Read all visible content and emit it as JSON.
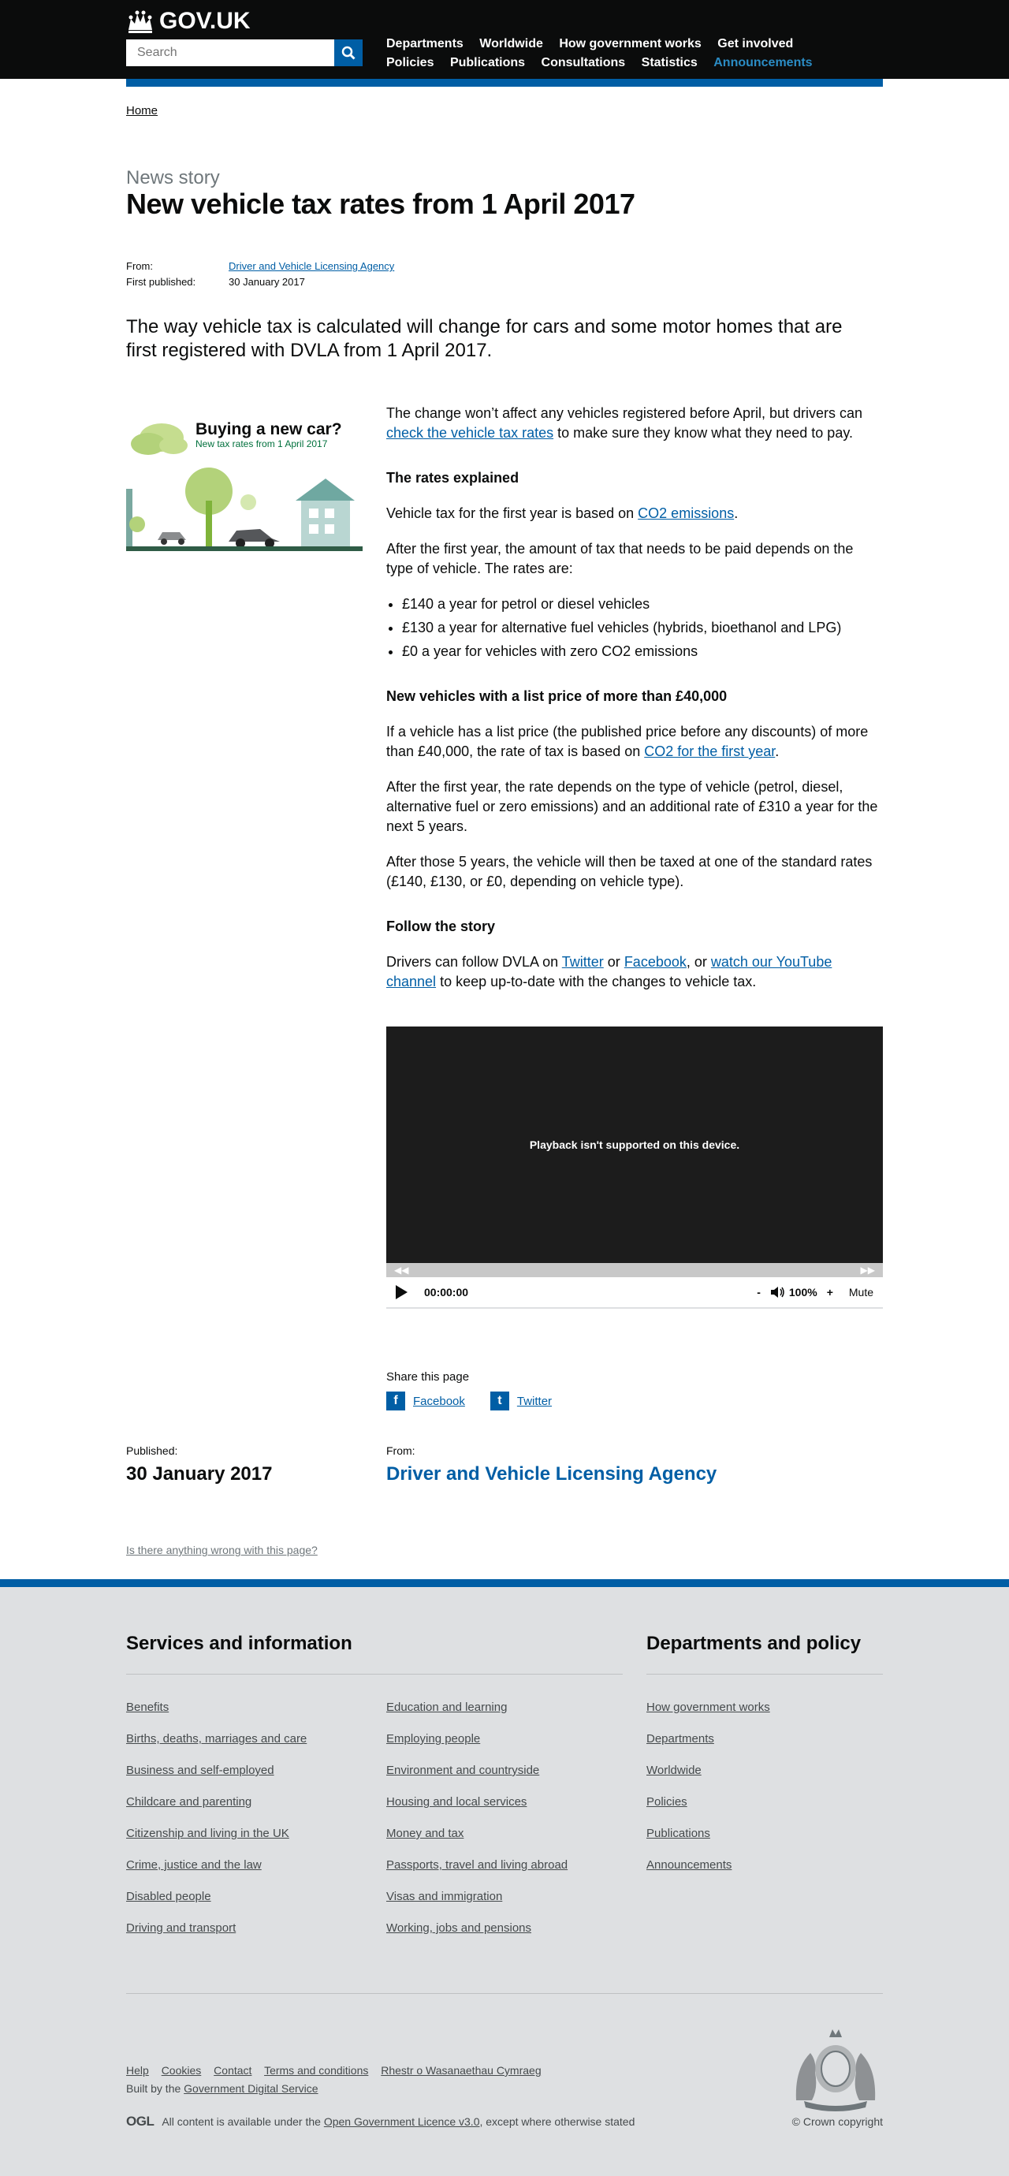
{
  "header": {
    "logo_text": "GOV.UK",
    "search_placeholder": "Search",
    "nav": [
      "Departments",
      "Worldwide",
      "How government works",
      "Get involved",
      "Policies",
      "Publications",
      "Consultations",
      "Statistics",
      "Announcements"
    ],
    "active_nav": "Announcements"
  },
  "breadcrumb": {
    "home": "Home"
  },
  "article": {
    "type": "News story",
    "title": "New vehicle tax rates from 1 April 2017",
    "from_label": "From:",
    "from_value": "Driver and Vehicle Licensing Agency",
    "first_published_label": "First published:",
    "first_published_value": "30 January 2017",
    "lead": "The way vehicle tax is calculated will change for cars and some motor homes that are first registered with DVLA from 1 April 2017.",
    "figure": {
      "heading": "Buying a new car?",
      "subheading": "New tax rates from 1 April 2017"
    },
    "p1_before": "The change won’t affect any vehicles registered before April, but drivers can ",
    "p1_link": "check the vehicle tax rates",
    "p1_after": " to make sure they know what they need to pay.",
    "h_rates": "The rates explained",
    "p2_before": "Vehicle tax for the first year is based on ",
    "p2_link": "CO2 emissions",
    "p2_after": ".",
    "p3": "After the first year, the amount of tax that needs to be paid depends on the type of vehicle. The rates are:",
    "rates": [
      "£140 a year for petrol or diesel vehicles",
      "£130 a year for alternative fuel vehicles (hybrids, bioethanol and LPG)",
      "£0 a year for vehicles with zero CO2 emissions"
    ],
    "h_list": "New vehicles with a list price of more than £40,000",
    "p4_before": "If a vehicle has a list price (the published price before any discounts) of more than £40,000, the rate of tax is based on ",
    "p4_link": "CO2 for the first year",
    "p4_after": ".",
    "p5": "After the first year, the rate depends on the type of vehicle (petrol, diesel, alternative fuel or zero emissions) and an additional rate of £310 a year for the next 5 years.",
    "p6": "After those 5 years, the vehicle will then be taxed at one of the standard rates (£140, £130, or £0, depending on vehicle type).",
    "h_follow": "Follow the story",
    "p7_a": "Drivers can follow DVLA on ",
    "p7_twitter": "Twitter",
    "p7_b": " or ",
    "p7_facebook": "Facebook",
    "p7_c": ", or ",
    "p7_youtube": "watch our YouTube channel",
    "p7_d": " to keep up-to-date with the changes to vehicle tax."
  },
  "video": {
    "message": "Playback isn't supported on this device.",
    "time": "00:00:00",
    "vol_down": "-",
    "volume": "100%",
    "vol_up": "+",
    "mute": "Mute",
    "progress": 0
  },
  "share": {
    "label": "Share this page",
    "facebook": "Facebook",
    "twitter": "Twitter"
  },
  "published": {
    "label": "Published:",
    "value": "30 January 2017"
  },
  "from": {
    "label": "From:",
    "value": "Driver and Vehicle Licensing Agency"
  },
  "report_link": "Is there anything wrong with this page?",
  "footer": {
    "services_heading": "Services and information",
    "services_col1": [
      "Benefits",
      "Births, deaths, marriages and care",
      "Business and self-employed",
      "Childcare and parenting",
      "Citizenship and living in the UK",
      "Crime, justice and the law",
      "Disabled people",
      "Driving and transport"
    ],
    "services_col2": [
      "Education and learning",
      "Employing people",
      "Environment and countryside",
      "Housing and local services",
      "Money and tax",
      "Passports, travel and living abroad",
      "Visas and immigration",
      "Working, jobs and pensions"
    ],
    "dept_heading": "Departments and policy",
    "dept_links": [
      "How government works",
      "Departments",
      "Worldwide",
      "Policies",
      "Publications",
      "Announcements"
    ],
    "meta_links": [
      "Help",
      "Cookies",
      "Contact",
      "Terms and conditions",
      "Rhestr o Wasanaethau Cymraeg"
    ],
    "built_by": "Built by the ",
    "built_link": "Government Digital Service",
    "ogl": "OGL",
    "licence_before": "All content is available under the ",
    "licence_link": "Open Government Licence v3.0",
    "licence_after": ", except where otherwise stated",
    "copyright": "© Crown copyright"
  },
  "colors": {
    "brand_blue": "#005ea5",
    "header_black": "#0b0c0c",
    "footer_grey": "#dee0e2"
  }
}
